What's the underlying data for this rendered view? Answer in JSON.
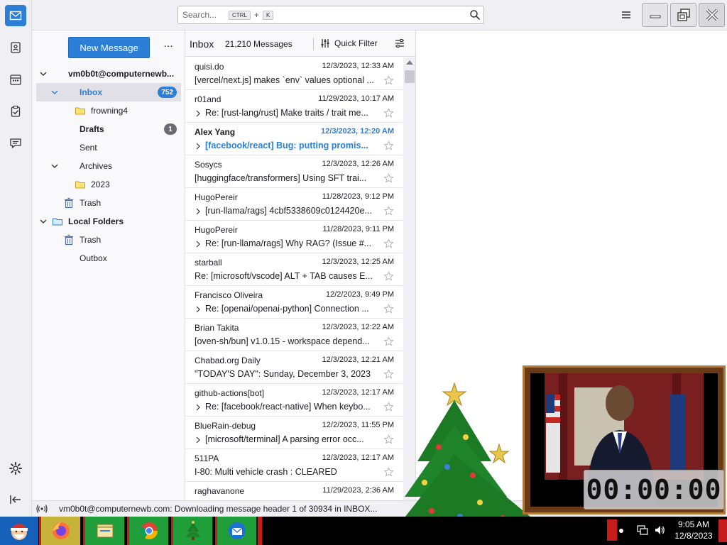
{
  "search": {
    "placeholder": "Search...",
    "key1": "CTRL",
    "plus": "+",
    "key2": "K"
  },
  "folder_pane": {
    "new_message_label": "New Message",
    "more_label": "...",
    "account": "vm0b0t@computernewb...",
    "folders": [
      {
        "name": "Inbox",
        "badge": "752"
      },
      {
        "name": "frowning4"
      },
      {
        "name": "Drafts",
        "badge": "1"
      },
      {
        "name": "Sent"
      },
      {
        "name": "Archives"
      },
      {
        "name": "2023"
      },
      {
        "name": "Trash"
      }
    ],
    "local_folders": {
      "name": "Local Folders",
      "items": [
        "Trash",
        "Outbox"
      ]
    }
  },
  "thread_pane": {
    "title": "Inbox",
    "count": "21,210 Messages",
    "quick_filter": "Quick Filter",
    "messages": [
      {
        "sender": "quisi.do",
        "date": "12/3/2023, 12:33 AM",
        "subject": "[vercel/next.js] makes `env` values optional ..."
      },
      {
        "sender": "r01and",
        "date": "11/29/2023, 10:17 AM",
        "subject": "Re: [rust-lang/rust] Make traits / trait me..."
      },
      {
        "sender": "Alex Yang",
        "date": "12/3/2023, 12:20 AM",
        "subject": "[facebook/react] Bug: putting promis..."
      },
      {
        "sender": "Sosycs",
        "date": "12/3/2023, 12:26 AM",
        "subject": "[huggingface/transformers] Using SFT trai..."
      },
      {
        "sender": "HugoPereir",
        "date": "11/28/2023, 9:12 PM",
        "subject": "[run-llama/rags] 4cbf5338609c0124420e..."
      },
      {
        "sender": "HugoPereir",
        "date": "11/28/2023, 9:11 PM",
        "subject": "Re: [run-llama/rags] Why RAG? (Issue #..."
      },
      {
        "sender": "starball",
        "date": "12/3/2023, 12:25 AM",
        "subject": "Re: [microsoft/vscode] ALT + TAB causes E..."
      },
      {
        "sender": "Francisco Oliveira",
        "date": "12/2/2023, 9:49 PM",
        "subject": "Re: [openai/openai-python] Connection ..."
      },
      {
        "sender": "Brian Takita",
        "date": "12/3/2023, 12:22 AM",
        "subject": "[oven-sh/bun] v1.0.15 - workspace depend..."
      },
      {
        "sender": "Chabad.org Daily",
        "date": "12/3/2023, 12:21 AM",
        "subject": "\"TODAY'S DAY\": Sunday, December 3, 2023"
      },
      {
        "sender": "github-actions[bot]",
        "date": "12/3/2023, 12:17 AM",
        "subject": "Re: [facebook/react-native] When keybo..."
      },
      {
        "sender": "BlueRain-debug",
        "date": "12/2/2023, 11:55 PM",
        "subject": "[microsoft/terminal] A parsing error occ..."
      },
      {
        "sender": "511PA",
        "date": "12/3/2023, 12:17 AM",
        "subject": "I-80: Multi vehicle crash : CLEARED"
      },
      {
        "sender": "raghavanone",
        "date": "11/29/2023, 2:36 AM",
        "subject": ""
      }
    ]
  },
  "status_bar": {
    "text": "vm0b0t@computernewb.com: Downloading message header 1 of 30934 in INBOX..."
  },
  "clock_widget": {
    "display": "00:00:00"
  },
  "taskbar": {
    "time": "9:05 AM",
    "date": "12/8/2023"
  },
  "colors": {
    "accent": "#2b7fd6",
    "taskbar_green": "#1f9e3a",
    "taskbar_red": "#c61c1c"
  }
}
